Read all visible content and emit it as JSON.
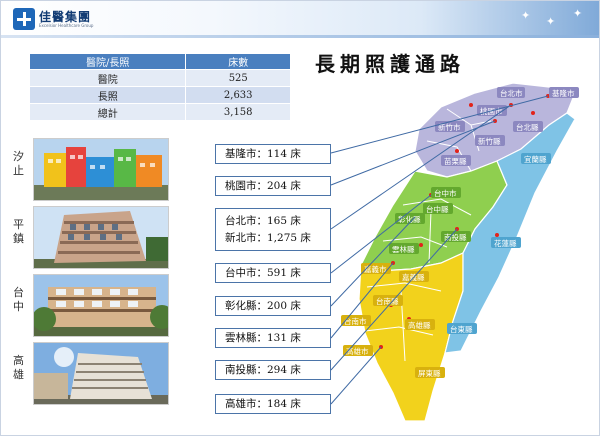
{
  "header": {
    "logo_name": "佳醫集團",
    "logo_sub": "Excelsior Healthcare Group"
  },
  "page_title": "長期照護通路",
  "table": {
    "columns": [
      "醫院/長照",
      "床數"
    ],
    "rows": [
      [
        "醫院",
        "525"
      ],
      [
        "長照",
        "2,633"
      ],
      [
        "總計",
        "3,158"
      ]
    ]
  },
  "photos": [
    {
      "label": "汐止",
      "icon": "building-photo"
    },
    {
      "label": "平鎮",
      "icon": "building-photo"
    },
    {
      "label": "台中",
      "icon": "building-photo"
    },
    {
      "label": "高雄",
      "icon": "building-photo"
    }
  ],
  "location_boxes": [
    {
      "lines": [
        "基隆市：114 床"
      ]
    },
    {
      "lines": [
        "桃園市：204 床"
      ]
    },
    {
      "lines": [
        "台北市：165 床",
        "新北市：1,275 床"
      ]
    },
    {
      "lines": [
        "台中市：591 床"
      ]
    },
    {
      "lines": [
        "彰化縣：200 床"
      ]
    },
    {
      "lines": [
        "雲林縣：131 床"
      ]
    },
    {
      "lines": [
        "南投縣：294 床"
      ]
    },
    {
      "lines": [
        "高雄市：184 床"
      ]
    }
  ],
  "map_labels": [
    "台北市",
    "基隆市",
    "桃園市",
    "新北市",
    "新竹市",
    "台北縣",
    "新竹縣",
    "苗栗縣",
    "宜蘭縣",
    "台中市",
    "台中縣",
    "彰化縣",
    "南投縣",
    "花蓮縣",
    "雲林縣",
    "嘉義市",
    "嘉義縣",
    "台南縣",
    "台南市",
    "高雄縣",
    "高雄市",
    "屏東縣",
    "台東縣"
  ],
  "colors": {
    "table_header": "#4a7fbf",
    "north_region": "#b9b6dc",
    "central_region": "#8fcf4f",
    "south_region": "#f2d21c",
    "east_region": "#7fc3e6",
    "connector_line": "#3f6aa4"
  }
}
